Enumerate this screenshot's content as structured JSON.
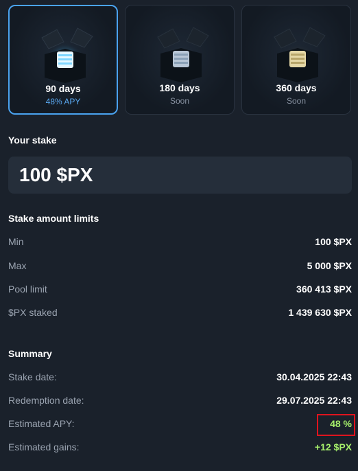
{
  "pools": [
    {
      "title": "90 days",
      "sub": "48% APY",
      "selected": true,
      "icon": "glowing-blue-cube-box-icon"
    },
    {
      "title": "180 days",
      "sub": "Soon",
      "selected": false,
      "icon": "blue-cube-box-icon"
    },
    {
      "title": "360 days",
      "sub": "Soon",
      "selected": false,
      "icon": "gold-cube-box-icon"
    }
  ],
  "stake": {
    "heading": "Your stake",
    "value": "100 $PX"
  },
  "limits": {
    "heading": "Stake amount limits",
    "rows": [
      {
        "label": "Min",
        "value": "100 $PX"
      },
      {
        "label": "Max",
        "value": "5 000 $PX"
      },
      {
        "label": "Pool limit",
        "value": "360 413 $PX"
      },
      {
        "label": "$PX staked",
        "value": "1 439 630 $PX"
      }
    ]
  },
  "summary": {
    "heading": "Summary",
    "rows": [
      {
        "label": "Stake date:",
        "value": "30.04.2025 22:43"
      },
      {
        "label": "Redemption date:",
        "value": "29.07.2025 22:43"
      },
      {
        "label": "Estimated APY:",
        "value": "48 %"
      },
      {
        "label": "Estimated gains:",
        "value": "+12 $PX"
      }
    ]
  },
  "colors": {
    "accent": "#4aa3f0",
    "positive": "#a6f06b",
    "highlight": "#e0141e",
    "background": "#1a212b"
  }
}
